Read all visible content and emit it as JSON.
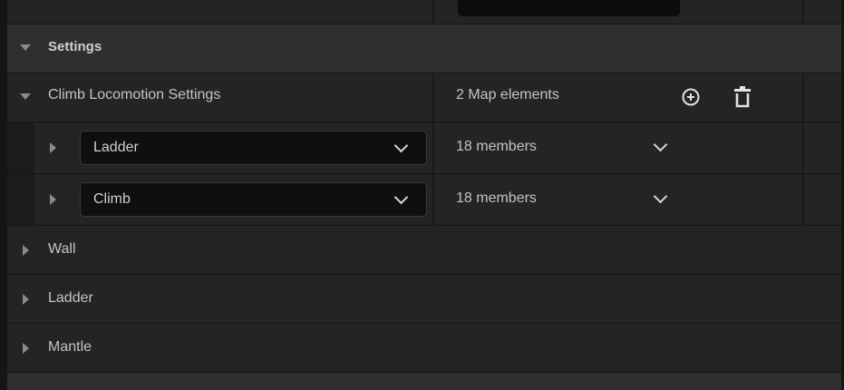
{
  "settings_section": {
    "label": "Settings"
  },
  "climb_locomotion": {
    "label": "Climb Locomotion Settings",
    "count_text": "2 Map elements",
    "add_icon": "plus-circle-icon",
    "delete_icon": "trash-icon"
  },
  "map_entries": [
    {
      "key": "Ladder",
      "value": "18 members"
    },
    {
      "key": "Climb",
      "value": "18 members"
    }
  ],
  "collapsed_sections": [
    {
      "label": "Wall"
    },
    {
      "label": "Ladder"
    },
    {
      "label": "Mantle"
    }
  ],
  "colors": {
    "panel_bg": "#242424",
    "header_bg": "#2f2f2f",
    "separator": "#151515",
    "field_bg": "#0f0f0f",
    "text": "#c4c4c4"
  }
}
